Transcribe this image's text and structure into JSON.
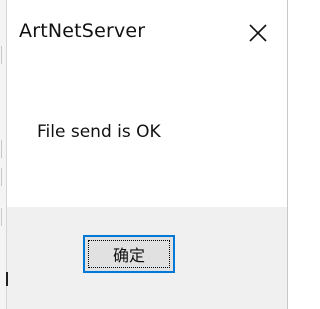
{
  "window": {
    "title": "ArtNetServer",
    "close_icon": "close-icon"
  },
  "message": {
    "text": "File send is OK"
  },
  "buttons": {
    "ok_label": "确定"
  },
  "colors": {
    "accent": "#0078d7",
    "footer_bg": "#f0f0f0",
    "button_bg": "#e1e1e1",
    "text": "#111111"
  }
}
